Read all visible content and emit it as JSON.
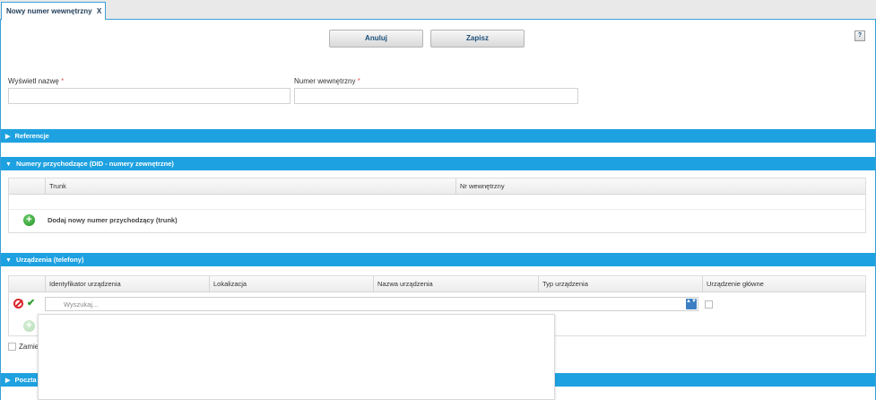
{
  "tab": {
    "title": "Nowy numer wewnętrzny",
    "close": "X"
  },
  "toolbar": {
    "cancel_label": "Anuluj",
    "save_label": "Zapisz",
    "help_label": "?"
  },
  "form": {
    "display_name_label": "Wyświetl nazwę",
    "display_name_value": "",
    "extension_label": "Numer wewnętrzny",
    "extension_value": "",
    "required_mark": "*"
  },
  "sections": {
    "references": {
      "title": "Referencje",
      "expanded": false
    },
    "incoming": {
      "title": "Numery przychodzące (DID - numery zewnętrzne)",
      "expanded": true
    },
    "devices": {
      "title": "Urządzenia (telefony)",
      "expanded": true
    },
    "mail": {
      "title": "Poczta",
      "expanded": false
    }
  },
  "incoming_grid": {
    "columns": [
      "Trunk",
      "Nr wewnętrzny"
    ],
    "add_label": "Dodaj nowy numer przychodzący (trunk)"
  },
  "devices_grid": {
    "columns": [
      "Identyfikator urządzenia",
      "Lokalizacja",
      "Nazwa urządzenia",
      "Typ urządzenia",
      "Urządzenie główne"
    ],
    "search_placeholder": "Wyszukaj...",
    "primary_checked": false
  },
  "partial_text": {
    "replace_label": "Zamie"
  },
  "icons": {
    "arrow_right": "▶",
    "arrow_down": "▼",
    "plus": "+",
    "check": "✔",
    "spin": "▲▼"
  },
  "colors": {
    "section_bar": "#1ea1e0",
    "accent": "#3aa0d8",
    "add_green": "#1e8f1e",
    "cancel_red": "#d9262c"
  }
}
